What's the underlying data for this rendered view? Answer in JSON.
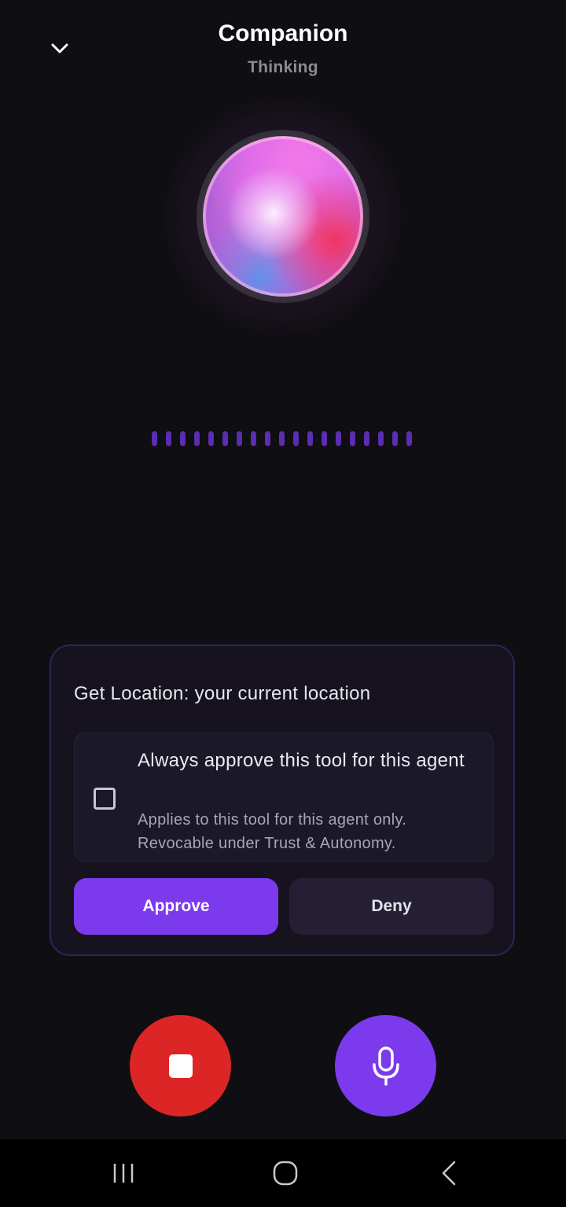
{
  "header": {
    "title": "Companion",
    "status": "Thinking",
    "collapse_icon": "chevron-down-icon"
  },
  "orb": {
    "colors": [
      "#f27ae6",
      "#ef3a6a",
      "#5a96eb",
      "#b765d9"
    ]
  },
  "waveform": {
    "bar_count": 19,
    "color": "#5b2db0"
  },
  "permission": {
    "title": "Get Location: your current location",
    "always_approve_label": "Always approve this tool for this agent",
    "always_approve_help": "Applies to this tool for this agent only. Revocable under Trust & Autonomy.",
    "always_approve_checked": false,
    "approve_label": "Approve",
    "deny_label": "Deny"
  },
  "controls": {
    "stop_icon": "stop-icon",
    "mic_icon": "microphone-icon",
    "stop_color": "#dc2626",
    "mic_color": "#7c3aed"
  },
  "navbar": {
    "recents_icon": "recents-icon",
    "home_icon": "home-icon",
    "back_icon": "back-icon"
  },
  "colors": {
    "accent": "#7c3aed",
    "background": "#0f0e12",
    "card_border": "#2c2556"
  }
}
